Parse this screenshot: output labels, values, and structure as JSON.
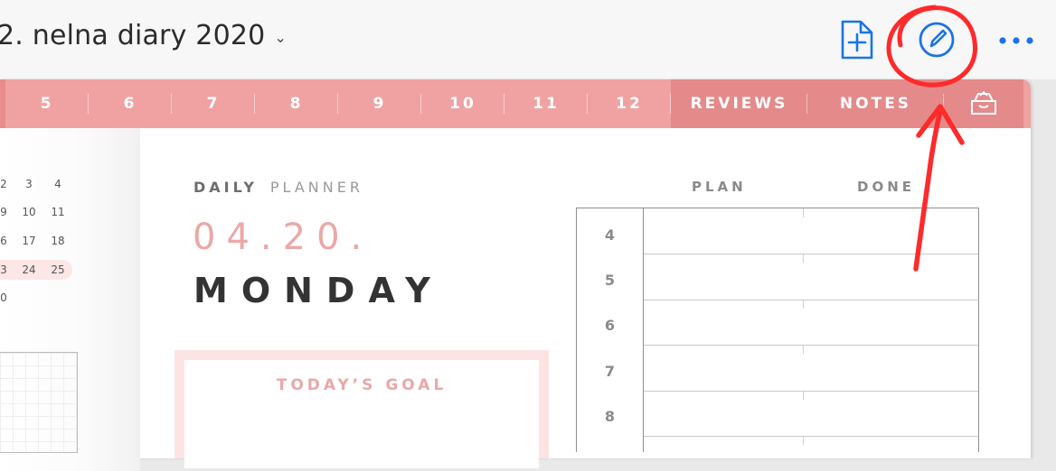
{
  "app": {
    "title": "2. nelna diary 2020",
    "accent": "#1a73e8",
    "icons": [
      "add-page-icon",
      "pencil-circle-icon",
      "more-icon",
      "chevron-down-icon",
      "inbox-icon"
    ]
  },
  "tabs": {
    "numbers": [
      "5",
      "6",
      "7",
      "8",
      "9",
      "10",
      "11",
      "12"
    ],
    "reviews": "REVIEWS",
    "notes": "NOTES",
    "color": "#f0a2a2"
  },
  "mini_calendar": {
    "rows": [
      [
        "2",
        "3",
        "4"
      ],
      [
        "9",
        "10",
        "11"
      ],
      [
        "6",
        "17",
        "18"
      ],
      [
        "3",
        "24",
        "25"
      ],
      [
        "0",
        "",
        ""
      ]
    ],
    "highlight_row": 3
  },
  "planner": {
    "label_bold": "DAILY",
    "label_light": "PLANNER",
    "date": "04.20.",
    "weekday": "MONDAY",
    "goal_title": "TODAY’S GOAL",
    "plan_header": "PLAN",
    "done_header": "DONE",
    "hours": [
      "4",
      "5",
      "6",
      "7",
      "8"
    ]
  }
}
